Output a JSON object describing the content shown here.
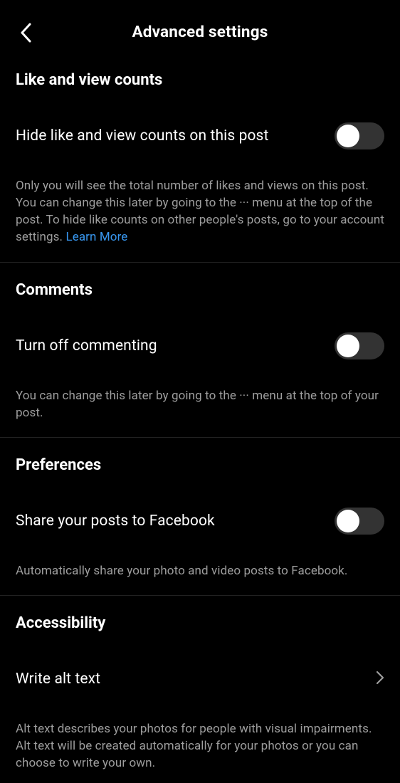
{
  "header": {
    "title": "Advanced settings"
  },
  "sections": {
    "likes": {
      "title": "Like and view counts",
      "toggle_label": "Hide like and view counts on this post",
      "description": "Only you will see the total number of likes and views on this post. You can change this later by going to the ··· menu at the top of the post. To hide like counts on other people's posts, go to your account settings. ",
      "learn_more": "Learn More"
    },
    "comments": {
      "title": "Comments",
      "toggle_label": "Turn off commenting",
      "description": "You can change this later by going to the ··· menu at the top of your post."
    },
    "preferences": {
      "title": "Preferences",
      "toggle_label": "Share your posts to Facebook",
      "description": "Automatically share your photo and video posts to Facebook."
    },
    "accessibility": {
      "title": "Accessibility",
      "row_label": "Write alt text",
      "description": "Alt text describes your photos for people with visual impairments. Alt text will be created automatically for your photos or you can choose to write your own."
    }
  }
}
